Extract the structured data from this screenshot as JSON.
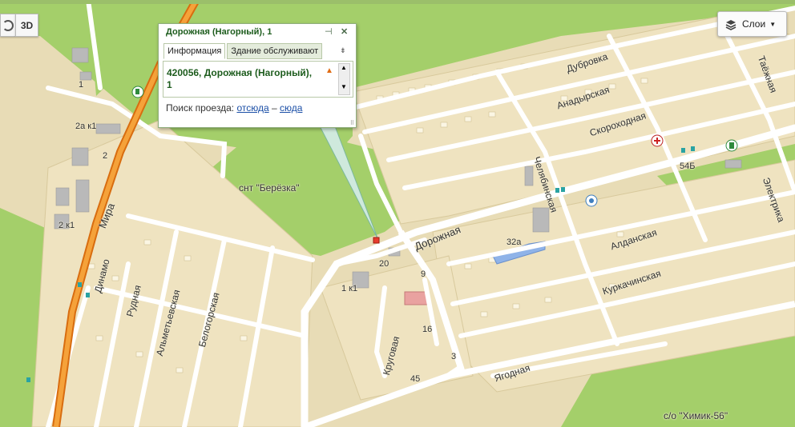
{
  "balloon": {
    "title": "Дорожная (Нагорный), 1",
    "tabs": [
      "Информация",
      "Здание обслуживают"
    ],
    "address": "420056, Дорожная (Нагорный), 1",
    "route_prefix": "Поиск проезда:",
    "route_from": "отсюда",
    "route_sep": "–",
    "route_to": "сюда"
  },
  "controls": {
    "view3d": "3D",
    "layers": "Слои"
  },
  "streets": {
    "mira": "Мира",
    "dinamo": "Динамо",
    "rudnaya": "Рудная",
    "almetevskaya": "Альметьевская",
    "belogorskaya": "Белогорская",
    "krugovaya": "Круговая",
    "dorozhnaya": "Дорожная",
    "chelyabinskaya": "Челябинская",
    "dubrovka": "Дубровка",
    "anadyrskaya": "Анадырская",
    "skorokhodnaya": "Скороходная",
    "taezhnaya": "Таёжная",
    "elektrika": "Электрика",
    "aldanskaya": "Алданская",
    "kurkachinskaya": "Куркачинская",
    "yagodnaya": "Ягодная"
  },
  "areas": {
    "snt_berezka": "снт \"Берёзка\"",
    "so_khimik": "с/о \"Химик-56\""
  },
  "house_numbers": {
    "n1_top": "1",
    "n2ak1": "2а к1",
    "n2": "2",
    "n2k1": "2 к1",
    "n20": "20",
    "n1k1": "1 к1",
    "n9": "9",
    "n32a": "32а",
    "n16": "16",
    "n3": "3",
    "n45": "45",
    "n54b": "54Б"
  },
  "colors": {
    "land": "#e8dcb6",
    "green": "#a4cf6a",
    "road": "#ffffff",
    "main_road": "#f28c1e",
    "building": "#f4efd8",
    "accent": "#1d5c1d"
  },
  "icons": [
    "pin-icon",
    "close-icon",
    "warning-icon",
    "layers-icon",
    "compass-icon",
    "hospital-icon",
    "fuel-icon",
    "mosque-icon",
    "bus-stop-icon"
  ]
}
